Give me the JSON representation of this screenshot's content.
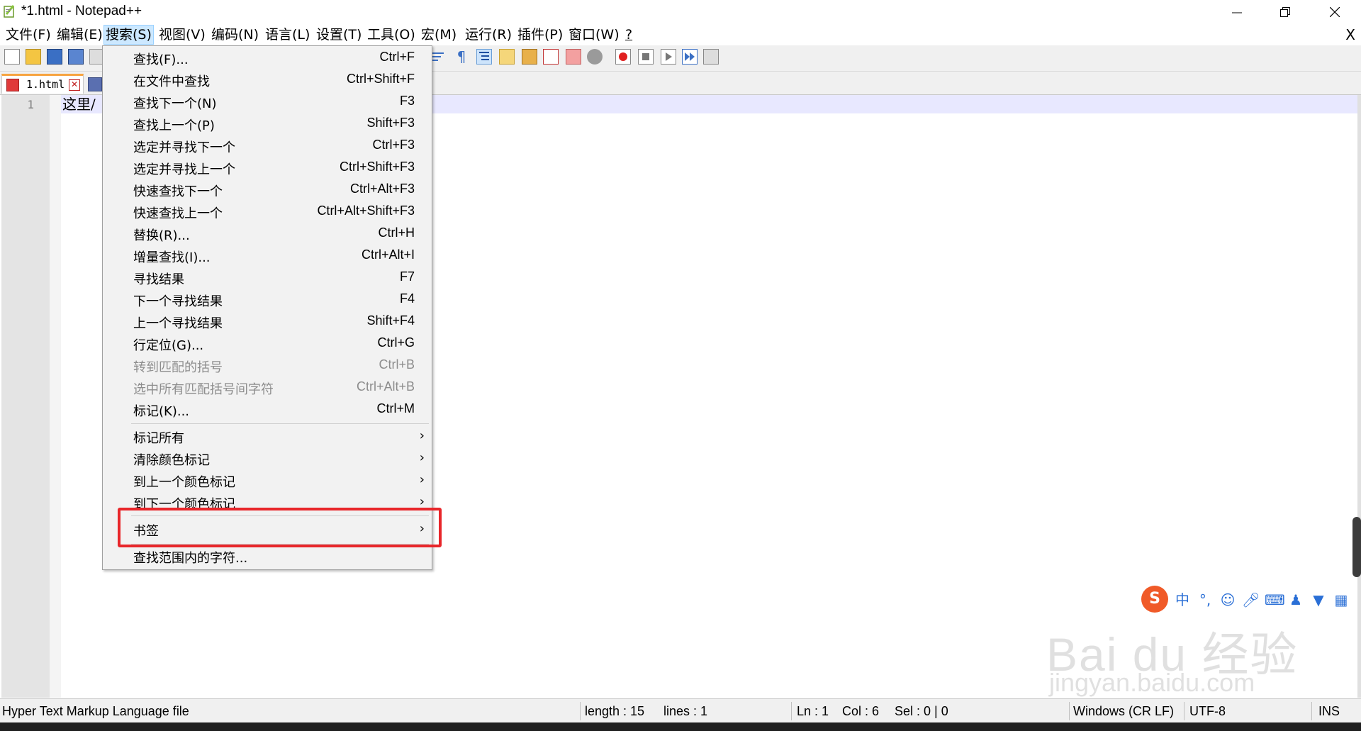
{
  "window": {
    "title": "*1.html - Notepad++"
  },
  "menubar": {
    "items": [
      "文件(F)",
      "编辑(E)",
      "搜索(S)",
      "视图(V)",
      "编码(N)",
      "语言(L)",
      "设置(T)",
      "工具(O)",
      "宏(M)",
      "运行(R)",
      "插件(P)",
      "窗口(W)",
      "?"
    ],
    "active": "搜索(S)",
    "close_doc": "X"
  },
  "tabs": [
    {
      "label": "1.html",
      "modified": true
    }
  ],
  "editor": {
    "line_number": "1",
    "visible_text": "这里/"
  },
  "search_menu": {
    "items": [
      {
        "label": "查找(F)...",
        "shortcut": "Ctrl+F",
        "enabled": true
      },
      {
        "label": "在文件中查找",
        "shortcut": "Ctrl+Shift+F",
        "enabled": true
      },
      {
        "label": "查找下一个(N)",
        "shortcut": "F3",
        "enabled": true
      },
      {
        "label": "查找上一个(P)",
        "shortcut": "Shift+F3",
        "enabled": true
      },
      {
        "label": "选定并寻找下一个",
        "shortcut": "Ctrl+F3",
        "enabled": true
      },
      {
        "label": "选定并寻找上一个",
        "shortcut": "Ctrl+Shift+F3",
        "enabled": true
      },
      {
        "label": "快速查找下一个",
        "shortcut": "Ctrl+Alt+F3",
        "enabled": true
      },
      {
        "label": "快速查找上一个",
        "shortcut": "Ctrl+Alt+Shift+F3",
        "enabled": true
      },
      {
        "label": "替换(R)...",
        "shortcut": "Ctrl+H",
        "enabled": true
      },
      {
        "label": "增量查找(I)...",
        "shortcut": "Ctrl+Alt+I",
        "enabled": true
      },
      {
        "label": "寻找结果",
        "shortcut": "F7",
        "enabled": true
      },
      {
        "label": "下一个寻找结果",
        "shortcut": "F4",
        "enabled": true
      },
      {
        "label": "上一个寻找结果",
        "shortcut": "Shift+F4",
        "enabled": true
      },
      {
        "label": "行定位(G)...",
        "shortcut": "Ctrl+G",
        "enabled": true
      },
      {
        "label": "转到匹配的括号",
        "shortcut": "Ctrl+B",
        "enabled": false
      },
      {
        "label": "选中所有匹配括号间字符",
        "shortcut": "Ctrl+Alt+B",
        "enabled": false
      },
      {
        "label": "标记(K)...",
        "shortcut": "Ctrl+M",
        "enabled": true
      }
    ],
    "submenus": [
      {
        "label": "标记所有"
      },
      {
        "label": "清除颜色标记"
      },
      {
        "label": "到上一个颜色标记"
      },
      {
        "label": "到下一个颜色标记"
      }
    ],
    "bookmark": {
      "label": "书签",
      "highlighted": true
    },
    "last_item": {
      "label": "查找范围内的字符..."
    }
  },
  "statusbar": {
    "file_type": "Hyper Text Markup Language file",
    "length": "length : 15",
    "lines": "lines : 1",
    "ln": "Ln : 1",
    "col": "Col : 6",
    "sel": "Sel : 0 | 0",
    "eol": "Windows (CR LF)",
    "encoding": "UTF-8",
    "mode": "INS"
  },
  "ime": {
    "logo": "S",
    "lang": "中",
    "punct": "°,"
  },
  "watermark": {
    "brand": "Bai du 经验",
    "url": "jingyan.baidu.com"
  },
  "colors": {
    "highlight_box": "#e8262a",
    "menu_active": "#cce8ff",
    "caret_line": "#e8e8ff",
    "tab_accent": "#f7a440"
  }
}
